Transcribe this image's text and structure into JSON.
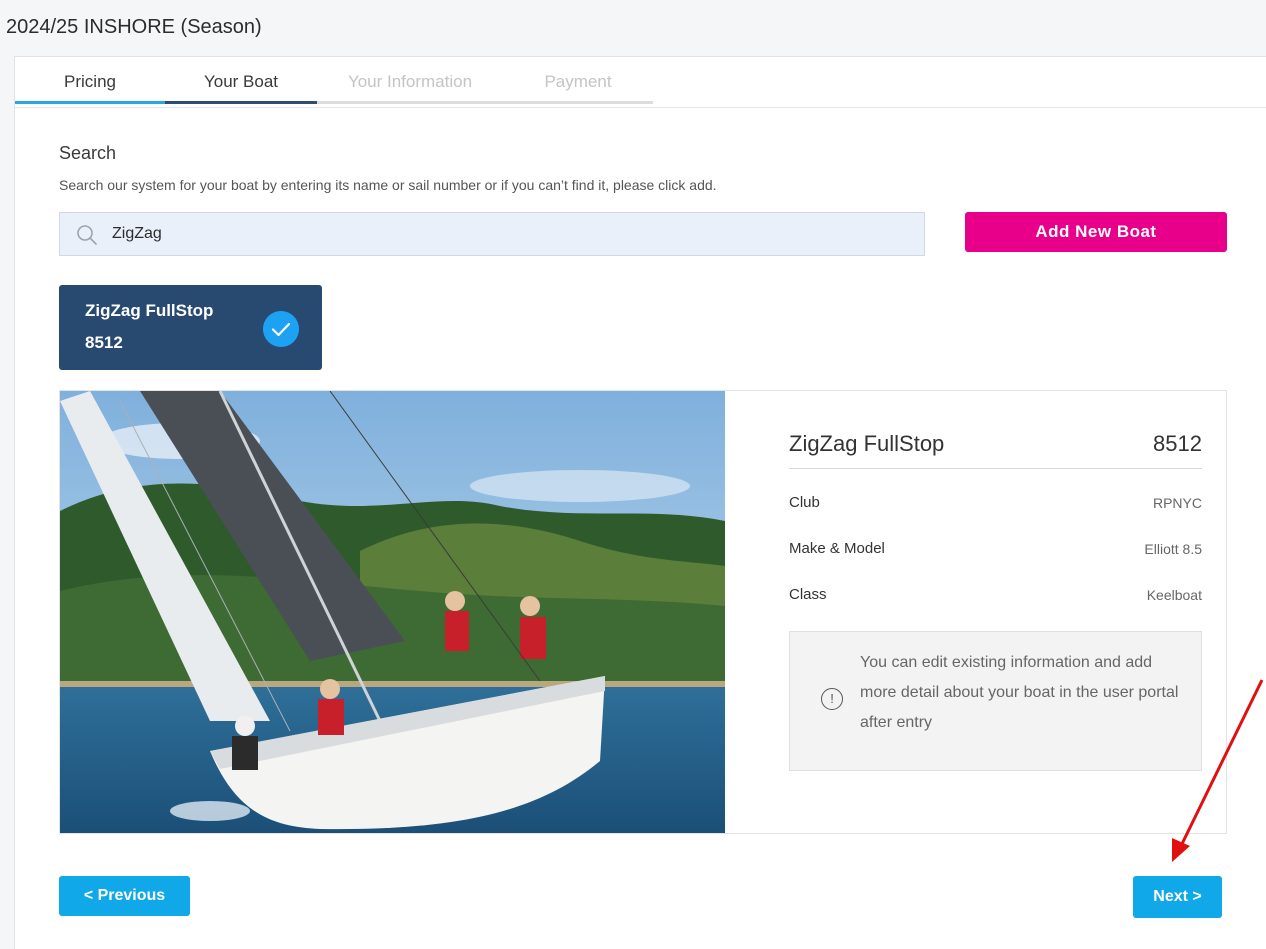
{
  "page": {
    "title": "2024/25 INSHORE (Season)"
  },
  "tabs": [
    {
      "label": "Pricing",
      "state": "done"
    },
    {
      "label": "Your Boat",
      "state": "active"
    },
    {
      "label": "Your Information",
      "state": "pending"
    },
    {
      "label": "Payment",
      "state": "pending"
    }
  ],
  "search": {
    "heading": "Search",
    "help": "Search our system for your boat by entering its name or sail number or if you can’t find it, please click add.",
    "value": "ZigZag",
    "add_label": "Add New Boat"
  },
  "result": {
    "name": "ZigZag FullStop",
    "number": "8512",
    "selected": true
  },
  "boat": {
    "name": "ZigZag FullStop",
    "sail_number": "8512",
    "rows": [
      {
        "label": "Club",
        "value": "RPNYC"
      },
      {
        "label": "Make & Model",
        "value": "Elliott 8.5"
      },
      {
        "label": "Class",
        "value": "Keelboat"
      }
    ],
    "note": "You can edit existing information and add more detail about your boat in the user portal after entry"
  },
  "nav": {
    "previous_label": "< Previous",
    "next_label": "Next >"
  },
  "colors": {
    "accent_pink": "#e8008a",
    "primary_blue": "#10a8e8",
    "selected_navy": "#284a70",
    "annotation_red": "#e01010"
  }
}
